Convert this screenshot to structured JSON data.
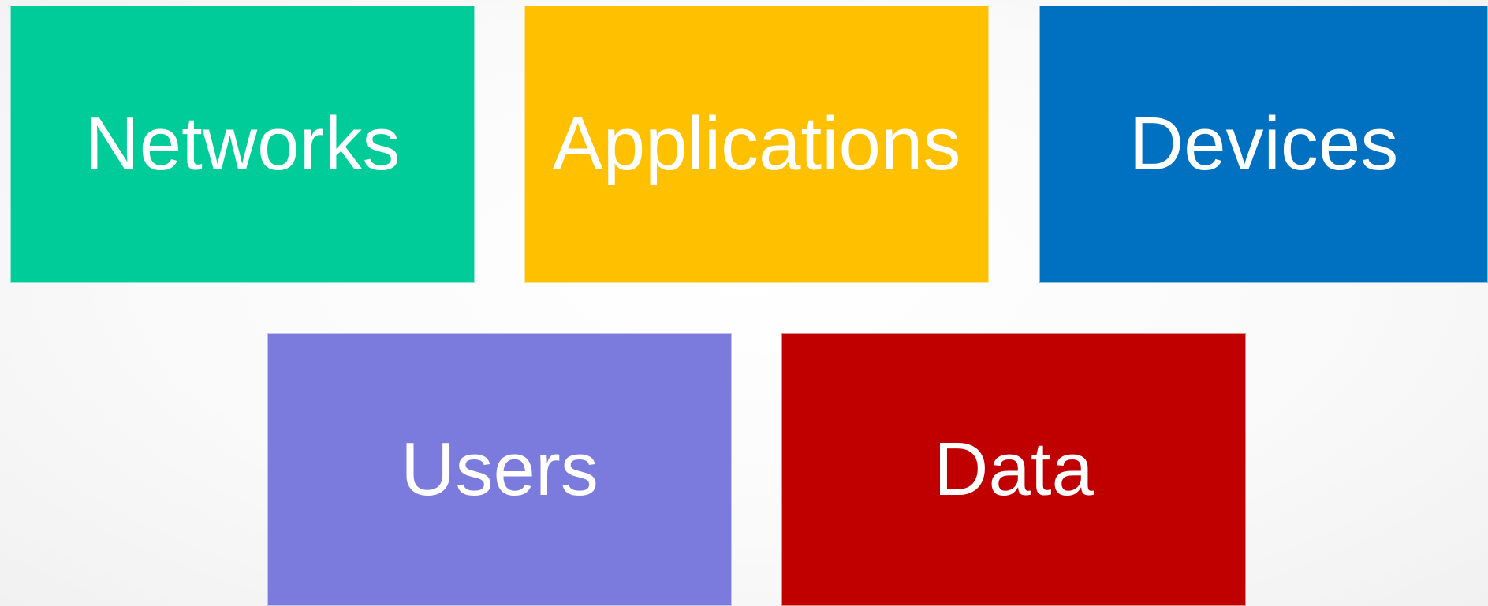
{
  "tiles": [
    {
      "label": "Networks",
      "color": "#00cc99"
    },
    {
      "label": "Applications",
      "color": "#ffc000"
    },
    {
      "label": "Devices",
      "color": "#0070c0"
    },
    {
      "label": "Users",
      "color": "#7b7bdd"
    },
    {
      "label": "Data",
      "color": "#c00000"
    }
  ]
}
